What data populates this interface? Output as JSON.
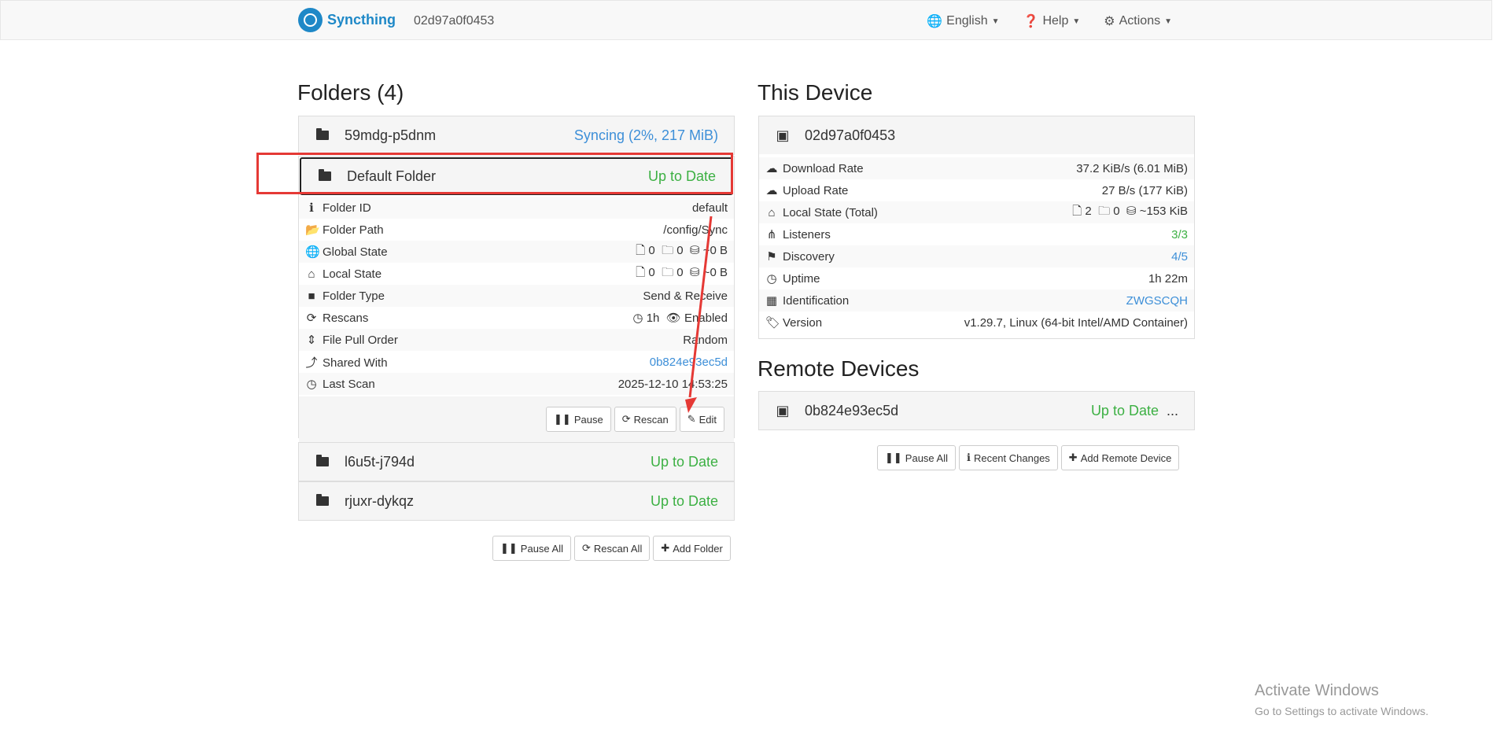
{
  "navbar": {
    "brand": "Syncthing",
    "device_name": "02d97a0f0453",
    "language": "English",
    "help": "Help",
    "actions": "Actions"
  },
  "folders": {
    "title": "Folders (4)",
    "items": [
      {
        "name": "59mdg-p5dnm",
        "status": "Syncing (2%, 217 MiB)"
      },
      {
        "name": "Default Folder",
        "status": "Up to Date"
      },
      {
        "name": "l6u5t-j794d",
        "status": "Up to Date"
      },
      {
        "name": "rjuxr-dykqz",
        "status": "Up to Date"
      }
    ],
    "details": {
      "folder_id_label": "Folder ID",
      "folder_id": "default",
      "folder_path_label": "Folder Path",
      "folder_path": "/config/Sync",
      "global_state_label": "Global State",
      "global_files": "0",
      "global_dirs": "0",
      "global_size": "~0 B",
      "local_state_label": "Local State",
      "local_files": "0",
      "local_dirs": "0",
      "local_size": "~0 B",
      "folder_type_label": "Folder Type",
      "folder_type": "Send & Receive",
      "rescans_label": "Rescans",
      "rescan_interval": "1h",
      "watch": "Enabled",
      "pull_order_label": "File Pull Order",
      "pull_order": "Random",
      "shared_with_label": "Shared With",
      "shared_with": "0b824e93ec5d",
      "last_scan_label": "Last Scan",
      "last_scan": "2025-12-10 14:53:25"
    },
    "buttons": {
      "pause": "Pause",
      "rescan": "Rescan",
      "edit": "Edit"
    },
    "footer_buttons": {
      "pause_all": "Pause All",
      "rescan_all": "Rescan All",
      "add_folder": "Add Folder"
    }
  },
  "this_device": {
    "title": "This Device",
    "name": "02d97a0f0453",
    "rows": {
      "download_label": "Download Rate",
      "download": "37.2 KiB/s (6.01 MiB)",
      "upload_label": "Upload Rate",
      "upload": "27 B/s (177 KiB)",
      "local_state_label": "Local State (Total)",
      "local_files": "2",
      "local_dirs": "0",
      "local_size": "~153 KiB",
      "listeners_label": "Listeners",
      "listeners": "3/3",
      "discovery_label": "Discovery",
      "discovery": "4/5",
      "uptime_label": "Uptime",
      "uptime": "1h 22m",
      "identification_label": "Identification",
      "identification": "ZWGSCQH",
      "version_label": "Version",
      "version": "v1.29.7, Linux (64-bit Intel/AMD Container)"
    }
  },
  "remote_devices": {
    "title": "Remote Devices",
    "items": [
      {
        "name": "0b824e93ec5d",
        "status": "Up to Date",
        "more": "..."
      }
    ],
    "buttons": {
      "pause_all": "Pause All",
      "recent_changes": "Recent Changes",
      "add_remote": "Add Remote Device"
    }
  },
  "watermark": {
    "line1": "Activate Windows",
    "line2": "Go to Settings to activate Windows."
  },
  "colors": {
    "accent": "#1e88c7",
    "up_to_date": "#3cb043",
    "syncing": "#3d8fd8",
    "highlight": "#e53935"
  }
}
